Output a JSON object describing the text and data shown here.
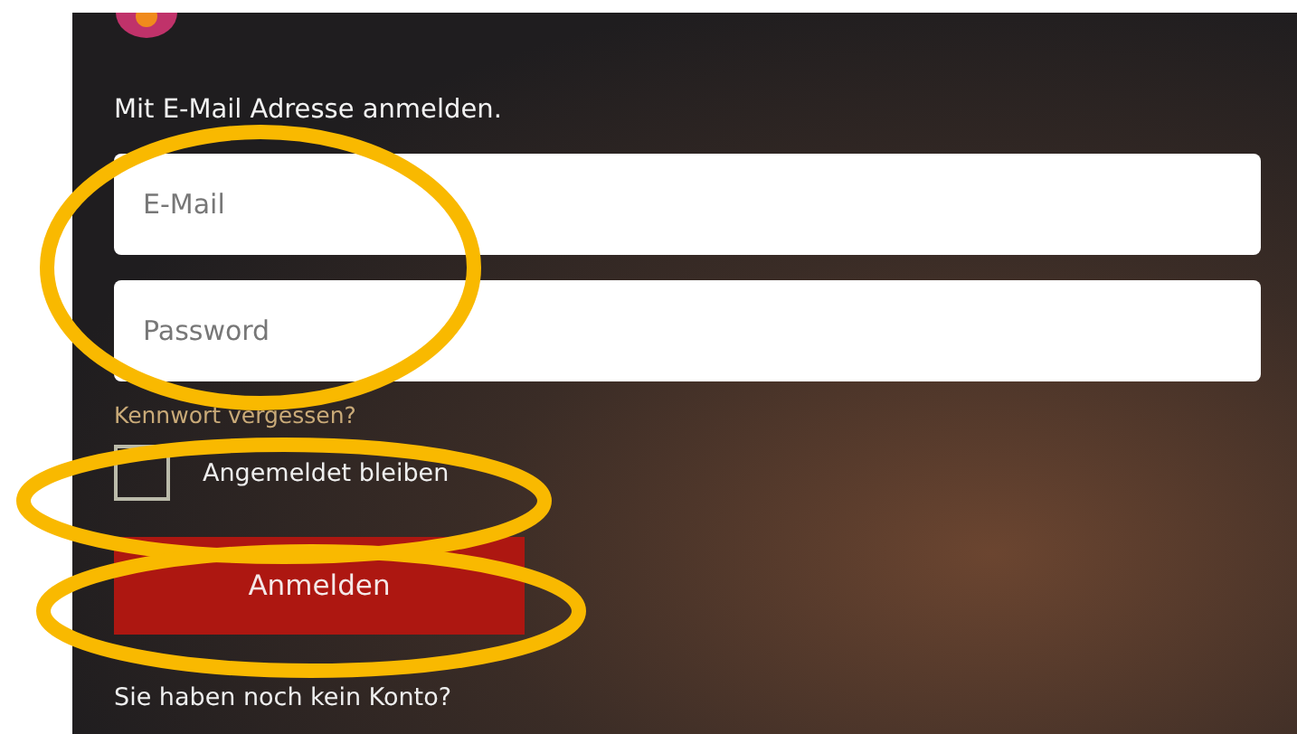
{
  "login": {
    "heading": "Mit E-Mail Adresse anmelden.",
    "fields": [
      {
        "placeholder": "E-Mail"
      },
      {
        "placeholder": "Password"
      }
    ],
    "forgot_link": "Kennwort vergessen?",
    "remember": {
      "label": "Angemeldet bleiben",
      "checked": false
    },
    "submit": "Anmelden",
    "signup_prompt": "Sie haben noch kein Konto?"
  }
}
